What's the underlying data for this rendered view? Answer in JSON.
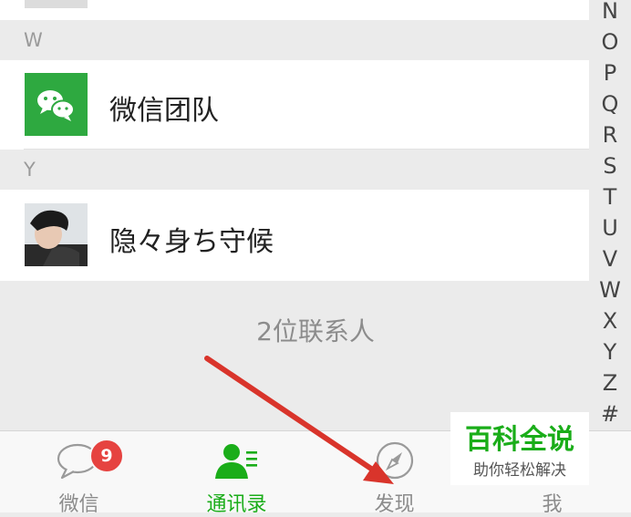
{
  "sections": [
    {
      "header": "W",
      "contacts": [
        {
          "name": "微信团队",
          "avatar": "wechat-logo-icon"
        }
      ]
    },
    {
      "header": "Y",
      "contacts": [
        {
          "name": "隐々身ち守候",
          "avatar": "user-photo"
        }
      ]
    }
  ],
  "contact_count_label": "2位联系人",
  "index_letters": [
    "N",
    "O",
    "P",
    "Q",
    "R",
    "S",
    "T",
    "U",
    "V",
    "W",
    "X",
    "Y",
    "Z",
    "#"
  ],
  "tabbar": {
    "tabs": [
      {
        "label": "微信",
        "icon": "chat-bubble-icon",
        "badge": "9"
      },
      {
        "label": "通讯录",
        "icon": "contacts-icon",
        "active": true
      },
      {
        "label": "发现",
        "icon": "compass-icon"
      },
      {
        "label": "我",
        "icon": "profile-icon"
      }
    ]
  },
  "watermark": {
    "title": "百科全说",
    "subtitle": "助你轻松解决"
  },
  "colors": {
    "accent": "#1aad19",
    "badge": "#e64340",
    "arrow": "#d9342b"
  }
}
